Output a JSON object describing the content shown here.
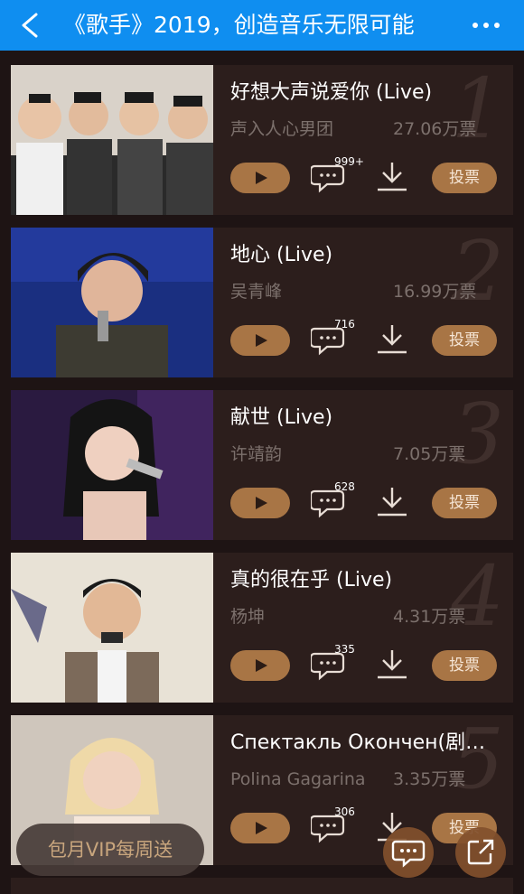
{
  "header": {
    "title": "《歌手》2019，创造音乐无限可能"
  },
  "songs": [
    {
      "rank": "1",
      "title": "好想大声说爱你 (Live)",
      "artist": "声入人心男团",
      "votes": "27.06万票",
      "comments": "999+",
      "vote_label": "投票"
    },
    {
      "rank": "2",
      "title": "地心 (Live)",
      "artist": "吴青峰",
      "votes": "16.99万票",
      "comments": "716",
      "vote_label": "投票"
    },
    {
      "rank": "3",
      "title": "献世 (Live)",
      "artist": "许靖韵",
      "votes": "7.05万票",
      "comments": "628",
      "vote_label": "投票"
    },
    {
      "rank": "4",
      "title": "真的很在乎 (Live)",
      "artist": "杨坤",
      "votes": "4.31万票",
      "comments": "335",
      "vote_label": "投票"
    },
    {
      "rank": "5",
      "title": "Спектакль Окончен(剧…",
      "artist": "Polina Gagarina",
      "votes": "3.35万票",
      "comments": "306",
      "vote_label": "投票"
    }
  ],
  "vip_banner": "包月VIP每周送",
  "colors": {
    "header": "#0f8ef0",
    "accent": "#a87545",
    "card": "#2c1e1c",
    "background": "#1e1414"
  }
}
